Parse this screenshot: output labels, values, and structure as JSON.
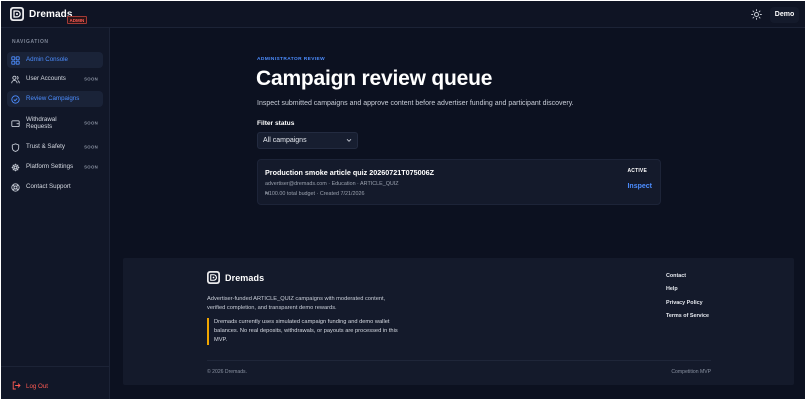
{
  "header": {
    "brand": "Dremads",
    "badge": "ADMIN",
    "theme_icon": "sun-icon",
    "user": "Demo"
  },
  "sidebar": {
    "heading": "NAVIGATION",
    "items": [
      {
        "label": "Admin Console",
        "icon": "dashboard-icon",
        "soon": "",
        "active": true
      },
      {
        "label": "User Accounts",
        "icon": "users-icon",
        "soon": "SOON",
        "active": false
      },
      {
        "label": "Review Campaigns",
        "icon": "check-circle-icon",
        "soon": "",
        "active": true
      },
      {
        "label": "Withdrawal Requests",
        "icon": "wallet-icon",
        "soon": "SOON",
        "active": false
      },
      {
        "label": "Trust & Safety",
        "icon": "shield-icon",
        "soon": "SOON",
        "active": false
      },
      {
        "label": "Platform Settings",
        "icon": "gear-icon",
        "soon": "SOON",
        "active": false
      },
      {
        "label": "Contact Support",
        "icon": "support-icon",
        "soon": "",
        "active": false
      }
    ],
    "logout": "Log Out"
  },
  "main": {
    "eyebrow": "ADMINISTRATOR REVIEW",
    "title": "Campaign review queue",
    "description": "Inspect submitted campaigns and approve content before advertiser funding and participant discovery.",
    "filter_label": "Filter status",
    "filter_value": "All campaigns",
    "campaigns": [
      {
        "title": "Production smoke article quiz 20260721T075006Z",
        "meta": "advertiser@dremads.com · Education · ARTICLE_QUIZ",
        "budget": "₦100.00 total budget · Created 7/21/2026",
        "status": "ACTIVE",
        "action": "Inspect"
      }
    ]
  },
  "footer": {
    "brand": "Dremads",
    "tagline": "Advertiser-funded ARTICLE_QUIZ campaigns with moderated content, verified completion, and transparent demo rewards.",
    "notice": "Dremads currently uses simulated campaign funding and demo wallet balances. No real deposits, withdrawals, or payouts are processed in this MVP.",
    "links": [
      "Contact",
      "Help",
      "Privacy Policy",
      "Terms of Service"
    ],
    "copyright": "© 2026 Dremads.",
    "stage": "Competition MVP"
  },
  "colors": {
    "accent": "#4c8dff",
    "danger": "#ff5a52",
    "warning": "#f0a500",
    "background": "#0c1120"
  }
}
